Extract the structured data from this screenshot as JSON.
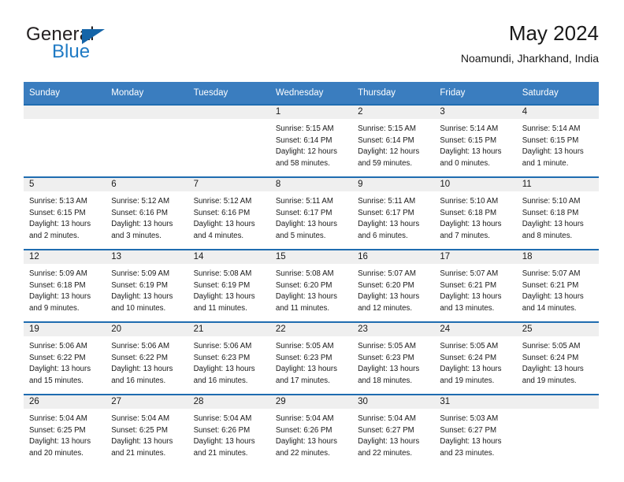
{
  "brand": {
    "word_general": "General",
    "word_blue": "Blue",
    "flag_icon": "triangle-flag-icon"
  },
  "header": {
    "title": "May 2024",
    "location": "Noamundi, Jharkhand, India"
  },
  "colors": {
    "header_blue": "#3a7dbf",
    "row_border_blue": "#1f6cb0",
    "daynum_band": "#efefef",
    "brand_blue": "#1f7ac4",
    "brand_flag": "#1565a8",
    "text": "#1a1a1a"
  },
  "calendar": {
    "weekday_headers": [
      "Sunday",
      "Monday",
      "Tuesday",
      "Wednesday",
      "Thursday",
      "Friday",
      "Saturday"
    ],
    "weeks": [
      [
        {
          "day": "",
          "empty": true
        },
        {
          "day": "",
          "empty": true
        },
        {
          "day": "",
          "empty": true
        },
        {
          "day": "1",
          "sunrise": "Sunrise: 5:15 AM",
          "sunset": "Sunset: 6:14 PM",
          "daylight1": "Daylight: 12 hours",
          "daylight2": "and 58 minutes."
        },
        {
          "day": "2",
          "sunrise": "Sunrise: 5:15 AM",
          "sunset": "Sunset: 6:14 PM",
          "daylight1": "Daylight: 12 hours",
          "daylight2": "and 59 minutes."
        },
        {
          "day": "3",
          "sunrise": "Sunrise: 5:14 AM",
          "sunset": "Sunset: 6:15 PM",
          "daylight1": "Daylight: 13 hours",
          "daylight2": "and 0 minutes."
        },
        {
          "day": "4",
          "sunrise": "Sunrise: 5:14 AM",
          "sunset": "Sunset: 6:15 PM",
          "daylight1": "Daylight: 13 hours",
          "daylight2": "and 1 minute."
        }
      ],
      [
        {
          "day": "5",
          "sunrise": "Sunrise: 5:13 AM",
          "sunset": "Sunset: 6:15 PM",
          "daylight1": "Daylight: 13 hours",
          "daylight2": "and 2 minutes."
        },
        {
          "day": "6",
          "sunrise": "Sunrise: 5:12 AM",
          "sunset": "Sunset: 6:16 PM",
          "daylight1": "Daylight: 13 hours",
          "daylight2": "and 3 minutes."
        },
        {
          "day": "7",
          "sunrise": "Sunrise: 5:12 AM",
          "sunset": "Sunset: 6:16 PM",
          "daylight1": "Daylight: 13 hours",
          "daylight2": "and 4 minutes."
        },
        {
          "day": "8",
          "sunrise": "Sunrise: 5:11 AM",
          "sunset": "Sunset: 6:17 PM",
          "daylight1": "Daylight: 13 hours",
          "daylight2": "and 5 minutes."
        },
        {
          "day": "9",
          "sunrise": "Sunrise: 5:11 AM",
          "sunset": "Sunset: 6:17 PM",
          "daylight1": "Daylight: 13 hours",
          "daylight2": "and 6 minutes."
        },
        {
          "day": "10",
          "sunrise": "Sunrise: 5:10 AM",
          "sunset": "Sunset: 6:18 PM",
          "daylight1": "Daylight: 13 hours",
          "daylight2": "and 7 minutes."
        },
        {
          "day": "11",
          "sunrise": "Sunrise: 5:10 AM",
          "sunset": "Sunset: 6:18 PM",
          "daylight1": "Daylight: 13 hours",
          "daylight2": "and 8 minutes."
        }
      ],
      [
        {
          "day": "12",
          "sunrise": "Sunrise: 5:09 AM",
          "sunset": "Sunset: 6:18 PM",
          "daylight1": "Daylight: 13 hours",
          "daylight2": "and 9 minutes."
        },
        {
          "day": "13",
          "sunrise": "Sunrise: 5:09 AM",
          "sunset": "Sunset: 6:19 PM",
          "daylight1": "Daylight: 13 hours",
          "daylight2": "and 10 minutes."
        },
        {
          "day": "14",
          "sunrise": "Sunrise: 5:08 AM",
          "sunset": "Sunset: 6:19 PM",
          "daylight1": "Daylight: 13 hours",
          "daylight2": "and 11 minutes."
        },
        {
          "day": "15",
          "sunrise": "Sunrise: 5:08 AM",
          "sunset": "Sunset: 6:20 PM",
          "daylight1": "Daylight: 13 hours",
          "daylight2": "and 11 minutes."
        },
        {
          "day": "16",
          "sunrise": "Sunrise: 5:07 AM",
          "sunset": "Sunset: 6:20 PM",
          "daylight1": "Daylight: 13 hours",
          "daylight2": "and 12 minutes."
        },
        {
          "day": "17",
          "sunrise": "Sunrise: 5:07 AM",
          "sunset": "Sunset: 6:21 PM",
          "daylight1": "Daylight: 13 hours",
          "daylight2": "and 13 minutes."
        },
        {
          "day": "18",
          "sunrise": "Sunrise: 5:07 AM",
          "sunset": "Sunset: 6:21 PM",
          "daylight1": "Daylight: 13 hours",
          "daylight2": "and 14 minutes."
        }
      ],
      [
        {
          "day": "19",
          "sunrise": "Sunrise: 5:06 AM",
          "sunset": "Sunset: 6:22 PM",
          "daylight1": "Daylight: 13 hours",
          "daylight2": "and 15 minutes."
        },
        {
          "day": "20",
          "sunrise": "Sunrise: 5:06 AM",
          "sunset": "Sunset: 6:22 PM",
          "daylight1": "Daylight: 13 hours",
          "daylight2": "and 16 minutes."
        },
        {
          "day": "21",
          "sunrise": "Sunrise: 5:06 AM",
          "sunset": "Sunset: 6:23 PM",
          "daylight1": "Daylight: 13 hours",
          "daylight2": "and 16 minutes."
        },
        {
          "day": "22",
          "sunrise": "Sunrise: 5:05 AM",
          "sunset": "Sunset: 6:23 PM",
          "daylight1": "Daylight: 13 hours",
          "daylight2": "and 17 minutes."
        },
        {
          "day": "23",
          "sunrise": "Sunrise: 5:05 AM",
          "sunset": "Sunset: 6:23 PM",
          "daylight1": "Daylight: 13 hours",
          "daylight2": "and 18 minutes."
        },
        {
          "day": "24",
          "sunrise": "Sunrise: 5:05 AM",
          "sunset": "Sunset: 6:24 PM",
          "daylight1": "Daylight: 13 hours",
          "daylight2": "and 19 minutes."
        },
        {
          "day": "25",
          "sunrise": "Sunrise: 5:05 AM",
          "sunset": "Sunset: 6:24 PM",
          "daylight1": "Daylight: 13 hours",
          "daylight2": "and 19 minutes."
        }
      ],
      [
        {
          "day": "26",
          "sunrise": "Sunrise: 5:04 AM",
          "sunset": "Sunset: 6:25 PM",
          "daylight1": "Daylight: 13 hours",
          "daylight2": "and 20 minutes."
        },
        {
          "day": "27",
          "sunrise": "Sunrise: 5:04 AM",
          "sunset": "Sunset: 6:25 PM",
          "daylight1": "Daylight: 13 hours",
          "daylight2": "and 21 minutes."
        },
        {
          "day": "28",
          "sunrise": "Sunrise: 5:04 AM",
          "sunset": "Sunset: 6:26 PM",
          "daylight1": "Daylight: 13 hours",
          "daylight2": "and 21 minutes."
        },
        {
          "day": "29",
          "sunrise": "Sunrise: 5:04 AM",
          "sunset": "Sunset: 6:26 PM",
          "daylight1": "Daylight: 13 hours",
          "daylight2": "and 22 minutes."
        },
        {
          "day": "30",
          "sunrise": "Sunrise: 5:04 AM",
          "sunset": "Sunset: 6:27 PM",
          "daylight1": "Daylight: 13 hours",
          "daylight2": "and 22 minutes."
        },
        {
          "day": "31",
          "sunrise": "Sunrise: 5:03 AM",
          "sunset": "Sunset: 6:27 PM",
          "daylight1": "Daylight: 13 hours",
          "daylight2": "and 23 minutes."
        },
        {
          "day": "",
          "empty": true
        }
      ]
    ]
  }
}
